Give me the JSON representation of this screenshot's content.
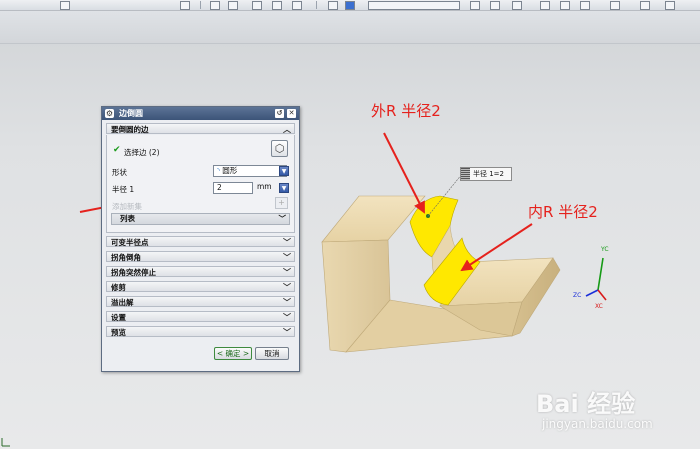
{
  "dialog": {
    "title": "边倒圆",
    "section_edges": "要倒圆的边",
    "select_edge_label": "选择边 (2)",
    "shape_label": "形状",
    "shape_value": "圆形",
    "radius_label": "半径 1",
    "radius_value": "2",
    "radius_unit": "mm",
    "add_set_label": "添加新集",
    "list_label": "列表",
    "sections": [
      "可变半径点",
      "拐角倒角",
      "拐角突然停止",
      "修剪",
      "溢出解",
      "设置",
      "预览"
    ],
    "ok_label": "< 确定 >",
    "cancel_label": "取消"
  },
  "annotations": {
    "outer": "外R 半径2",
    "inner": "内R 半径2"
  },
  "tooltip": {
    "text": "半径 1=2"
  },
  "axes": {
    "y": "YC",
    "z": "ZC",
    "x": "XC"
  },
  "watermark": {
    "main": "Bai 经验",
    "url": "jingyan.baidu.com"
  },
  "colors": {
    "fillet_highlight": "#ffe800",
    "part_body": "#e6d4ab",
    "arrow_red": "#e5221d",
    "dialog_title": "#3c5478"
  }
}
